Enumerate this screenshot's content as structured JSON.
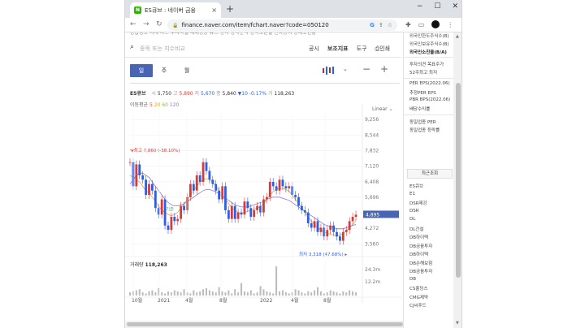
{
  "browser": {
    "tab_title": "ES큐브 : 네이버 금융",
    "favicon": "N",
    "tab_close": "×",
    "new_tab": "+",
    "window_buttons": [
      "−",
      "☐",
      "✕"
    ],
    "url": "finance.naver.com/item/fchart.naver?code=050120",
    "nav_icons": [
      "back-icon",
      "forward-icon",
      "reload-icon"
    ]
  },
  "toolbar": {
    "search_placeholder": "종목 또는 지수비교",
    "links": [
      "공시",
      "보조지표",
      "도구",
      "인쇄"
    ]
  },
  "periods": [
    "일",
    "주",
    "월"
  ],
  "active_period": "일",
  "quote": {
    "name": "ES큐브",
    "open_label": "시",
    "open": "5,750",
    "high_label": "고",
    "high": "5,890",
    "low_label": "저",
    "low": "5,670",
    "close_label": "종",
    "close": "5,840",
    "change": "▼10",
    "change_pct": "-0.17%",
    "volume_label": "거",
    "volume": "118,263"
  },
  "ma_legend": {
    "label": "이동평균",
    "p5": "5",
    "p20": "20",
    "p60": "60",
    "p120": "120"
  },
  "scale_type": "Linear",
  "volume_panel": {
    "label": "거래량",
    "value": "118,263"
  },
  "colors": {
    "up": "#d63b3b",
    "down": "#2d5ee5",
    "accent": "#4864b4",
    "ma5": "#ee4f4f",
    "ma20": "#e8a133",
    "ma60": "#89c24a",
    "ma120": "#8f79d0"
  },
  "chart_data": {
    "type": "line",
    "title": "",
    "y_ticks": [
      9256,
      8544,
      7832,
      7120,
      6408,
      5696,
      4272,
      3560
    ],
    "current_price_label": "4,895",
    "ylim": [
      3200,
      9600
    ],
    "x_ticks": [
      "10월",
      "2021",
      "4월",
      "8월",
      "2022",
      "4월",
      "8월"
    ],
    "annotations": {
      "high": {
        "text": "최고 7,860 (-38.10%)",
        "value": 7860
      },
      "low": {
        "text": "최저 3,318 (47.68%)",
        "value": 3318
      },
      "mid": {
        "text": "기준",
        "value": 5150
      }
    },
    "x": [
      0,
      4,
      8,
      12,
      16,
      20,
      24,
      28,
      32,
      36,
      40,
      44,
      48,
      52,
      56,
      60,
      64,
      68,
      72,
      76,
      80,
      84,
      88,
      92,
      96,
      100,
      104,
      108,
      112,
      116,
      120,
      124,
      128,
      132,
      136,
      140,
      144,
      148,
      152,
      156,
      160,
      164,
      168,
      172,
      176,
      180,
      184,
      188,
      192,
      196,
      200,
      204,
      208,
      212,
      216,
      220,
      224,
      228,
      232,
      236,
      240,
      244,
      248,
      252,
      256,
      260,
      264,
      268,
      272,
      276,
      280,
      284
    ],
    "series": [
      {
        "name": "price",
        "values": [
          7300,
          6200,
          7200,
          6700,
          6500,
          5800,
          6300,
          6000,
          5200,
          4900,
          5600,
          4400,
          4200,
          4800,
          4600,
          4700,
          5300,
          5100,
          5700,
          6300,
          6000,
          6700,
          6400,
          7300,
          6900,
          6500,
          6300,
          6000,
          5600,
          6200,
          5100,
          4700,
          5300,
          4700,
          5000,
          4900,
          5500,
          5200,
          4800,
          5100,
          5300,
          5000,
          5600,
          5700,
          6400,
          6200,
          6000,
          6500,
          6200,
          6100,
          6200,
          5800,
          5700,
          5300,
          5100,
          5000,
          4500,
          4300,
          4600,
          4100,
          4300,
          3900,
          4200,
          4400,
          4100,
          3900,
          3700,
          4100,
          4200,
          4600,
          4800,
          4895
        ]
      },
      {
        "name": "ma20",
        "values": [
          6700,
          6600,
          6500,
          6400,
          6200,
          6000,
          5900,
          5700,
          5500,
          5300,
          5100,
          5000,
          4900,
          4850,
          4900,
          5000,
          5200,
          5400,
          5600,
          5800,
          6000,
          6200,
          6400,
          6500,
          6550,
          6500,
          6400,
          6200,
          6000,
          5800,
          5600,
          5400,
          5200,
          5100,
          5000,
          4950,
          5000,
          5050,
          5100,
          5150,
          5200,
          5250,
          5400,
          5600,
          5800,
          5950,
          6050,
          6100,
          6100,
          6050,
          5950,
          5800,
          5600,
          5400,
          5200,
          5000,
          4800,
          4600,
          4450,
          4300,
          4200,
          4100,
          4050,
          4000,
          3950,
          3900,
          3950,
          4050,
          4150,
          4300,
          4450,
          4600
        ]
      },
      {
        "name": "ma120",
        "values": [
          6300,
          6500,
          6700,
          6800,
          6800,
          6700,
          6600,
          6400,
          6200,
          6000,
          5800,
          5600,
          5450,
          5350,
          5300,
          5300,
          5350,
          5400,
          5500,
          5600,
          5700,
          5800,
          5900,
          6000,
          6050,
          6050,
          6000,
          5950,
          5850,
          5750,
          5650,
          5550,
          5450,
          5350,
          5300,
          5250,
          5250,
          5250,
          5300,
          5350,
          5400,
          5450,
          5500,
          5600,
          5650,
          5700,
          5700,
          5700,
          5650,
          5600,
          5550,
          5450,
          5350,
          5250,
          5150,
          5050,
          4950,
          4850,
          4750,
          4650,
          4550,
          4450,
          4400,
          4350,
          4300,
          4250,
          4250,
          4250,
          4300,
          4350,
          4400,
          4450
        ]
      }
    ],
    "volume_ticks": [
      "24.3m",
      "12.2m"
    ],
    "volume": [
      3,
      4,
      5,
      6,
      3,
      2,
      4,
      5,
      3,
      7,
      3,
      2,
      4,
      3,
      5,
      4,
      3,
      6,
      3,
      2,
      5,
      3,
      4,
      6,
      7,
      5,
      4,
      3,
      8,
      4,
      3,
      5,
      2,
      6,
      3,
      12,
      4,
      3,
      5,
      2,
      3,
      9,
      6,
      4,
      3,
      2,
      28,
      4,
      5,
      3,
      2,
      3,
      6,
      5,
      3,
      2,
      4,
      3,
      5,
      8,
      4,
      2,
      3,
      5,
      4,
      3,
      2,
      4,
      3,
      5,
      4,
      3
    ],
    "grid": true
  },
  "sidebar": {
    "top_items": [
      "외국인한도주식수(B)",
      "외국인보유주식수(B)",
      "외국인소진율(B/A)",
      "투자의견   목표주가",
      "52주최고   최저",
      "PER   EPS(2022.06)",
      "추정PER   EPS",
      "PBR   BPS(2022.06)",
      "배당수익률",
      "동일업종 PER",
      "동일업종 등락률"
    ],
    "recent_label": "최근조회",
    "recent_items": [
      "ES큐브",
      "E1",
      "DSR제강",
      "DSR",
      "DL",
      "DL건설",
      "DB하이텍",
      "DB금융투자",
      "DB하이텍",
      "DB손해보험",
      "DB금융투자",
      "DB",
      "CS홀딩스",
      "CMG제약",
      "CJ씨푸드"
    ]
  }
}
